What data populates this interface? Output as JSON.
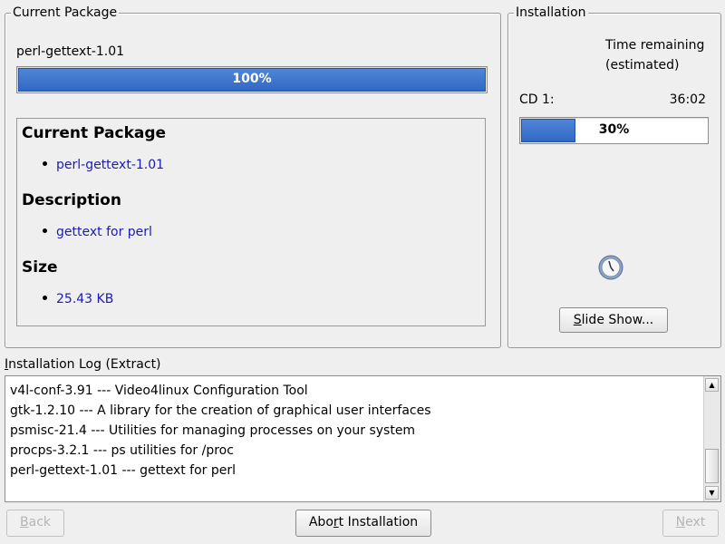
{
  "current_package": {
    "frame_title": "Current Package",
    "package_name": "perl-gettext-1.01",
    "progress_label": "100%",
    "progress_value": 1.0,
    "info": {
      "package_heading": "Current Package",
      "package_value": "perl-gettext-1.01",
      "description_heading": "Description",
      "description_value": "gettext for perl",
      "size_heading": "Size",
      "size_value": "25.43 KB"
    }
  },
  "installation": {
    "frame_title": "Installation",
    "time_remaining_line1": "Time remaining",
    "time_remaining_line2": "(estimated)",
    "cd_label": "CD 1:",
    "cd_time": "36:02",
    "progress_label": "30%",
    "progress_value": 0.3,
    "slideshow_button": {
      "label_underlined": "S",
      "label_rest": "lide Show..."
    }
  },
  "log": {
    "title_underlined": "I",
    "title_rest": "nstallation Log (Extract)",
    "lines": [
      "v4l-conf-3.91 --- Video4linux Configuration Tool",
      "gtk-1.2.10 --- A library for the creation of graphical user interfaces",
      "psmisc-21.4 --- Utilities for managing processes on your system",
      "procps-3.2.1 --- ps utilities for /proc",
      "perl-gettext-1.01 --- gettext for perl"
    ]
  },
  "buttons": {
    "back": {
      "underlined": "B",
      "rest": "ack"
    },
    "abort": {
      "before": "Abo",
      "underlined": "r",
      "after": "t Installation"
    },
    "next": {
      "underlined": "N",
      "rest": "ext"
    }
  },
  "colors": {
    "progress_fill": "#3a72cf",
    "info_value_text": "#1b1bb3"
  },
  "icons": {
    "busy": "clock-icon",
    "scroll_up": "arrow-up-icon",
    "scroll_down": "arrow-down-icon"
  }
}
